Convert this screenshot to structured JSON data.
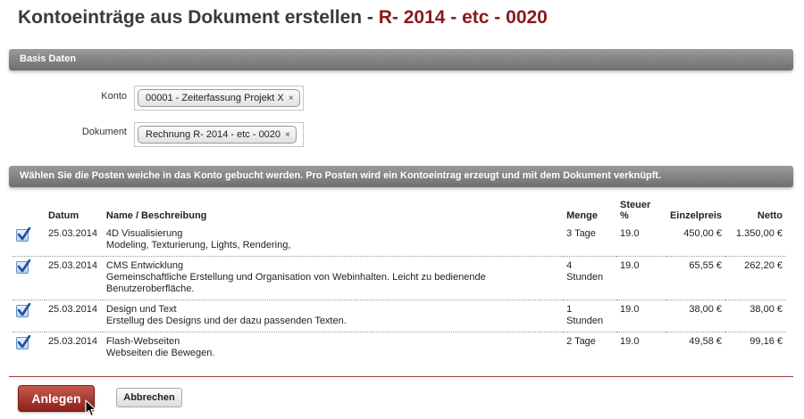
{
  "page": {
    "title_prefix": "Kontoeinträge aus Dokument erstellen - ",
    "title_ref": "R- 2014 - etc - 0020"
  },
  "basis": {
    "header": "Basis Daten",
    "konto_label": "Konto",
    "konto_value": "00001 - Zeiterfassung Projekt X",
    "dokument_label": "Dokument",
    "dokument_value": "Rechnung R- 2014 - etc - 0020",
    "remove_glyph": "×"
  },
  "posten": {
    "header": "Wählen Sie die Posten weiche in das Konto gebucht werden. Pro Posten wird ein Kontoeintrag erzeugt und mit dem Dokument verknüpft.",
    "columns": {
      "datum": "Datum",
      "name": "Name / Beschreibung",
      "menge": "Menge",
      "steuer_1": "Steuer",
      "steuer_2": "%",
      "einzelpreis": "Einzelpreis",
      "netto": "Netto"
    },
    "rows": [
      {
        "checked": true,
        "datum": "25.03.2014",
        "name": "4D Visualisierung",
        "desc_1": "Modeling, Texturierung, Lights, Rendering,",
        "desc_2": "",
        "menge_1": "3 Tage",
        "menge_2": "",
        "steuer": "19.0",
        "einzelpreis": "450,00 €",
        "netto": "1.350,00 €"
      },
      {
        "checked": true,
        "datum": "25.03.2014",
        "name": "CMS Entwicklung",
        "desc_1": "Gemeinschaftliche Erstellung und Organisation von Webinhalten. Leicht zu bedienende",
        "desc_2": "Benutzeroberfläche.",
        "menge_1": "4",
        "menge_2": "Stunden",
        "steuer": "19.0",
        "einzelpreis": "65,55 €",
        "netto": "262,20 €"
      },
      {
        "checked": true,
        "datum": "25.03.2014",
        "name": "Design und Text",
        "desc_1": "Erstellug des Designs und der dazu passenden Texten.",
        "desc_2": "",
        "menge_1": "1",
        "menge_2": "Stunden",
        "steuer": "19.0",
        "einzelpreis": "38,00 €",
        "netto": "38,00 €"
      },
      {
        "checked": true,
        "datum": "25.03.2014",
        "name": "Flash-Webseiten",
        "desc_1": "Webseiten die Bewegen.",
        "desc_2": "",
        "menge_1": "2 Tage",
        "menge_2": "",
        "steuer": "19.0",
        "einzelpreis": "49,58 €",
        "netto": "99,16 €"
      }
    ]
  },
  "actions": {
    "submit_label": "Anlegen",
    "cancel_label": "Abbrechen"
  },
  "colors": {
    "accent": "#8b1a1a",
    "section_bar": "#7f7f7f",
    "checkbox_blue": "#1f4f9f"
  }
}
